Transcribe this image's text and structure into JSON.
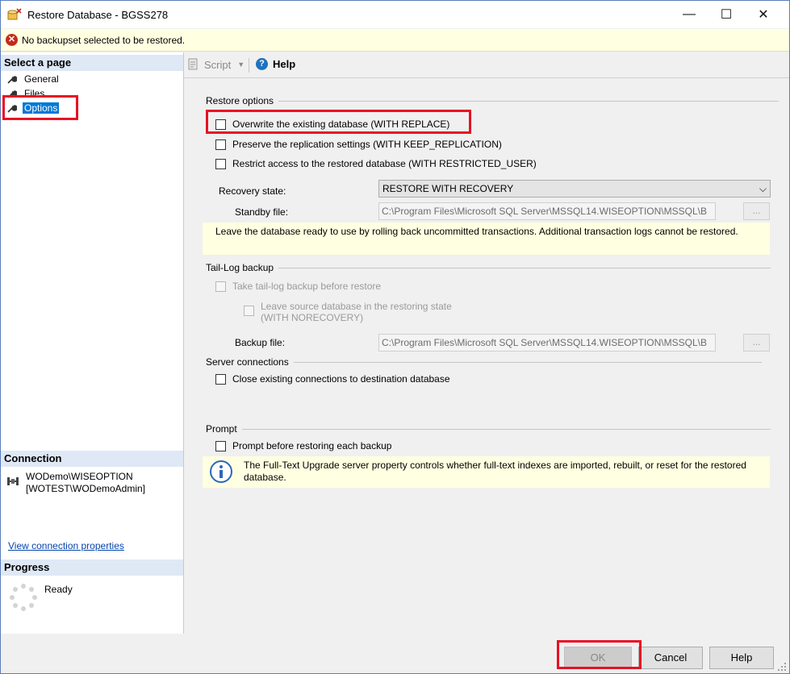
{
  "window": {
    "title": "Restore Database - BGSS278",
    "controls": {
      "minimize": "—",
      "maximize": "☐",
      "close": "✕"
    }
  },
  "message": {
    "icon": "error-icon",
    "text": "No backupset selected to be restored."
  },
  "sidebar": {
    "select_page_title": "Select a page",
    "items": [
      {
        "label": "General",
        "icon": "wrench-icon",
        "selected": false
      },
      {
        "label": "Files",
        "icon": "wrench-icon",
        "selected": false
      },
      {
        "label": "Options",
        "icon": "wrench-icon",
        "selected": true
      }
    ],
    "connection_title": "Connection",
    "connection_line1": "WODemo\\WISEOPTION",
    "connection_line2": "[WOTEST\\WODemoAdmin]",
    "view_connection_link": "View connection properties",
    "progress_title": "Progress",
    "progress_status": "Ready"
  },
  "toolbar": {
    "script_label": "Script",
    "help_label": "Help"
  },
  "restore_options": {
    "title": "Restore options",
    "overwrite": "Overwrite the existing database (WITH REPLACE)",
    "preserve_replication": "Preserve the replication settings (WITH KEEP_REPLICATION)",
    "restrict_access": "Restrict access to the restored database (WITH RESTRICTED_USER)",
    "recovery_state_label": "Recovery state:",
    "recovery_state_value": "RESTORE WITH RECOVERY",
    "standby_file_label": "Standby file:",
    "standby_file_value": "C:\\Program Files\\Microsoft SQL Server\\MSSQL14.WISEOPTION\\MSSQL\\B",
    "browse_label": "...",
    "info_text": "Leave the database ready to use by rolling back uncommitted transactions. Additional transaction logs cannot be restored."
  },
  "tail_log": {
    "title": "Tail-Log backup",
    "take_tail_log": "Take tail-log backup before restore",
    "leave_source_line1": "Leave source database in the restoring state",
    "leave_source_line2": "(WITH NORECOVERY)",
    "backup_file_label": "Backup file:",
    "backup_file_value": "C:\\Program Files\\Microsoft SQL Server\\MSSQL14.WISEOPTION\\MSSQL\\B",
    "browse_label": "..."
  },
  "server_connections": {
    "title": "Server connections",
    "close_existing": "Close existing connections to destination database"
  },
  "prompt": {
    "title": "Prompt",
    "prompt_before": "Prompt before restoring each backup",
    "info_text": "The Full-Text Upgrade server property controls whether full-text indexes are imported, rebuilt, or reset for the restored database."
  },
  "buttons": {
    "ok": "OK",
    "cancel": "Cancel",
    "help": "Help"
  },
  "colors": {
    "highlight": "#e81123",
    "selection": "#0078d7",
    "info_background": "#ffffe1",
    "section_header": "#dfe8f5"
  }
}
